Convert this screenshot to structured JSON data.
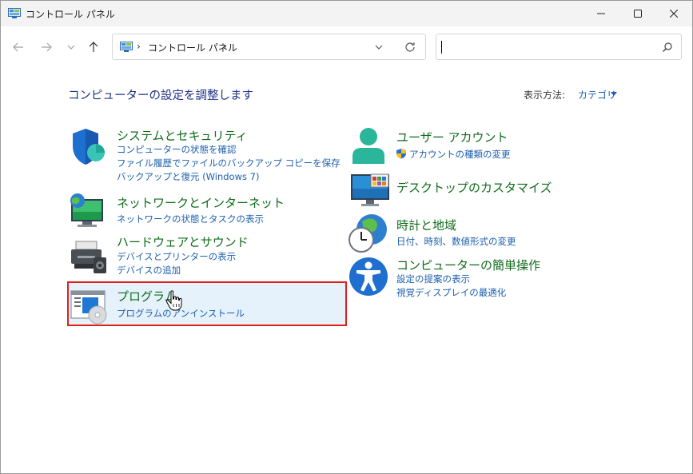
{
  "window": {
    "title": "コントロール パネル",
    "controls": {
      "minimize": "minimize",
      "maximize": "maximize",
      "close": "close"
    }
  },
  "nav": {
    "back": "back-arrow",
    "forward": "forward-arrow",
    "recent": "chevron-down",
    "up": "up-arrow"
  },
  "address": {
    "sep": "›",
    "path": "コントロール パネル",
    "sep2": "›"
  },
  "search": {
    "value": "",
    "placeholder": ""
  },
  "main": {
    "heading": "コンピューターの設定を調整します",
    "view_by_label": "表示方法:",
    "view_by_value": "カテゴリ"
  },
  "categories": [
    {
      "title": "システムとセキュリティ",
      "icon": "shield-icon",
      "links": [
        "コンピューターの状態を確認",
        "ファイル履歴でファイルのバックアップ コピーを保存",
        "バックアップと復元 (Windows 7)"
      ]
    },
    {
      "title": "ネットワークとインターネット",
      "icon": "network-globe-icon",
      "links": [
        "ネットワークの状態とタスクの表示"
      ]
    },
    {
      "title": "ハードウェアとサウンド",
      "icon": "printer-speaker-icon",
      "links": [
        "デバイスとプリンターの表示",
        "デバイスの追加"
      ]
    },
    {
      "title": "プログラム",
      "icon": "programs-icon",
      "links": [
        "プログラムのアンインストール"
      ]
    },
    {
      "title": "ユーザー アカウント",
      "icon": "user-accounts-icon",
      "links": [
        "アカウントの種類の変更"
      ]
    },
    {
      "title": "デスクトップのカスタマイズ",
      "icon": "desktop-monitor-icon",
      "links": []
    },
    {
      "title": "時計と地域",
      "icon": "clock-globe-icon",
      "links": [
        "日付、時刻、数値形式の変更"
      ]
    },
    {
      "title": "コンピューターの簡単操作",
      "icon": "accessibility-icon",
      "links": [
        "設定の提案の表示",
        "視覚ディスプレイの最適化"
      ]
    }
  ],
  "colors": {
    "heading": "#1e3287",
    "category_title": "#0f6b1a",
    "link": "#1d5fae",
    "highlight_bg": "#e5f1fb",
    "highlight_border": "#e0201c"
  }
}
